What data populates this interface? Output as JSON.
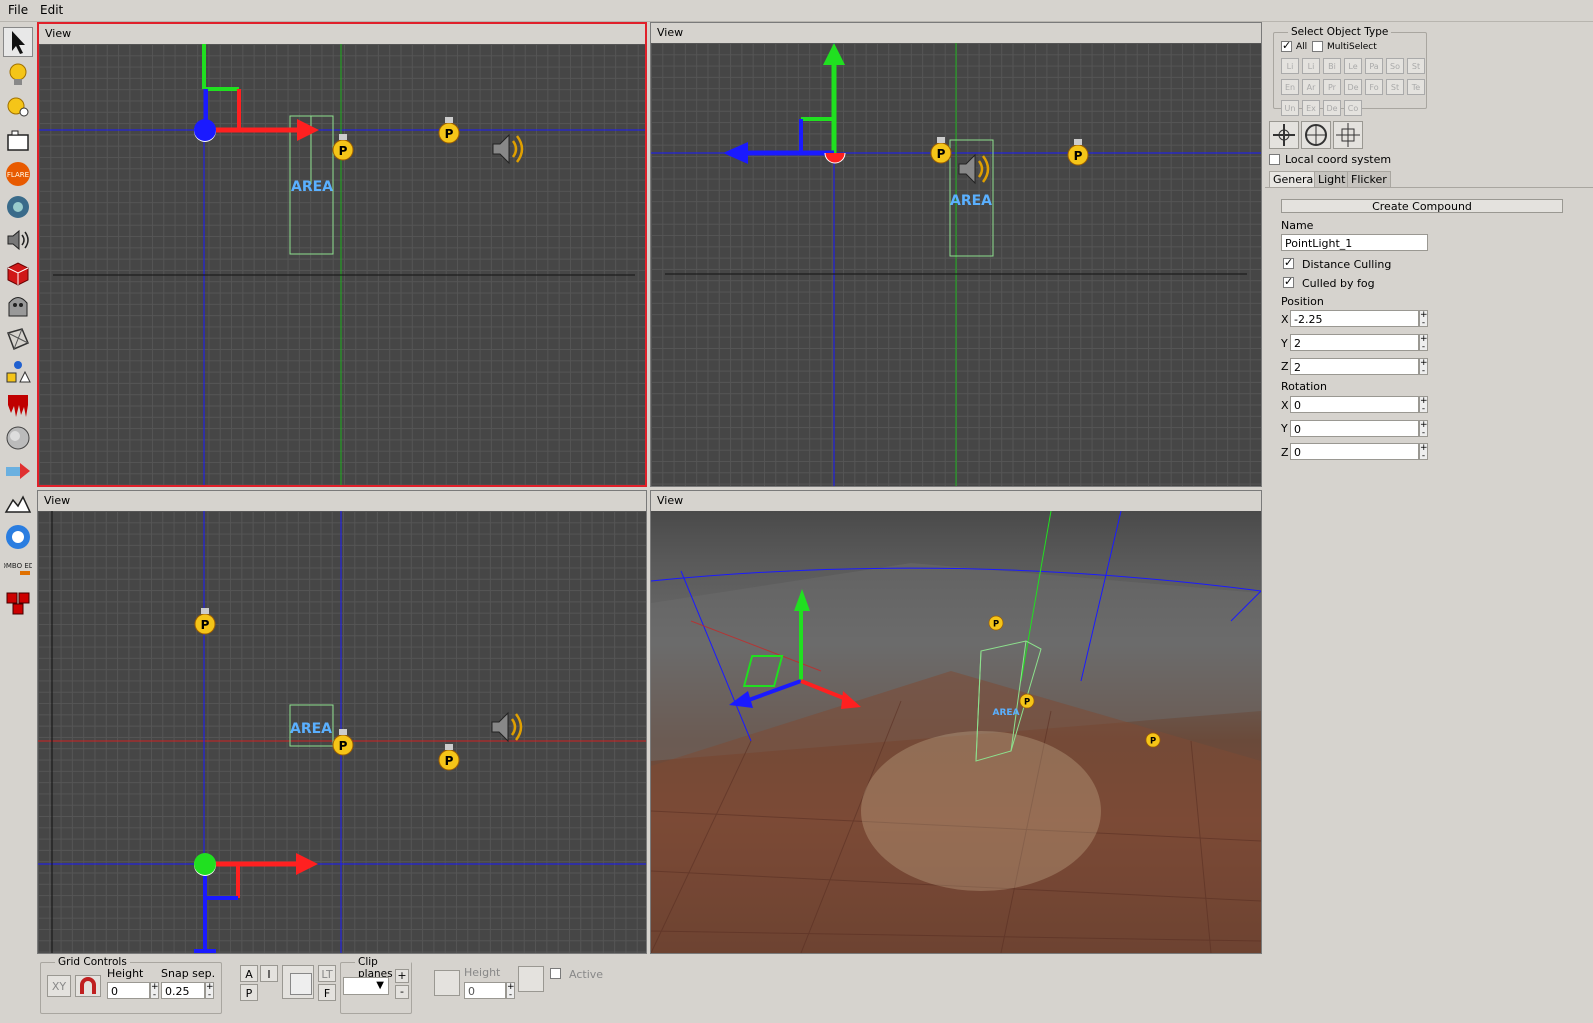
{
  "menu": {
    "file": "File",
    "edit": "Edit"
  },
  "toolbar": {
    "tools": [
      "select-arrow-icon",
      "point-light-icon",
      "spot-light-icon",
      "box-light-icon",
      "flare-icon",
      "particle-icon",
      "sound-icon",
      "static-object-icon",
      "entity-icon",
      "area-icon",
      "primitive-icon",
      "decal-icon",
      "fog-icon",
      "start-pos-icon",
      "terrain-icon",
      "billboard-icon",
      "combo-edit-icon",
      "compound-icon"
    ],
    "flare_label": "FLARE",
    "combo_label": "COMBO EDIT"
  },
  "viewports": {
    "top_left": {
      "title": "View"
    },
    "top_right": {
      "title": "View"
    },
    "bottom_left": {
      "title": "View"
    },
    "bottom_right": {
      "title": "View"
    },
    "area_label": "AREA",
    "light_label": "P"
  },
  "panel": {
    "select_object_type": {
      "title": "Select Object Type",
      "all_label": "All",
      "all_checked": true,
      "multiselect_label": "MultiSelect",
      "multiselect_checked": false,
      "types": [
        "Li",
        "Li",
        "Bi",
        "Le",
        "Pa",
        "So",
        "St",
        "En",
        "Ar",
        "Pr",
        "De",
        "Fo",
        "St",
        "Te",
        "Un",
        "Ex",
        "De",
        "Co"
      ]
    },
    "local_coord_label": "Local coord system",
    "tabs": [
      "General",
      "Light",
      "Flicker"
    ],
    "create_compound": "Create Compound",
    "name_label": "Name",
    "name_value": "PointLight_1",
    "distance_culling": "Distance Culling",
    "culled_by_fog": "Culled by fog",
    "position_label": "Position",
    "position": {
      "x": "-2.25",
      "y": "2",
      "z": "2"
    },
    "rotation_label": "Rotation",
    "rotation": {
      "x": "0",
      "y": "0",
      "z": "0"
    },
    "axis": {
      "x": "X",
      "y": "Y",
      "z": "Z"
    }
  },
  "bottom": {
    "grid_controls": "Grid Controls",
    "xy": "XY",
    "height_label": "Height",
    "height_value": "0",
    "snap_label": "Snap sep.",
    "snap_value": "0.25",
    "a": "A",
    "i": "I",
    "p": "P",
    "lt": "LT",
    "f": "F",
    "clip_planes": "Clip planes",
    "plus": "+",
    "minus": "-",
    "clip_height_label": "Height",
    "clip_height_value": "0",
    "active_label": "Active"
  },
  "colors": {
    "active_border": "#e0202a",
    "axis_x": "#ff2020",
    "axis_y": "#20e020",
    "axis_z": "#1a1aff",
    "area_text": "#5ab0ff"
  }
}
